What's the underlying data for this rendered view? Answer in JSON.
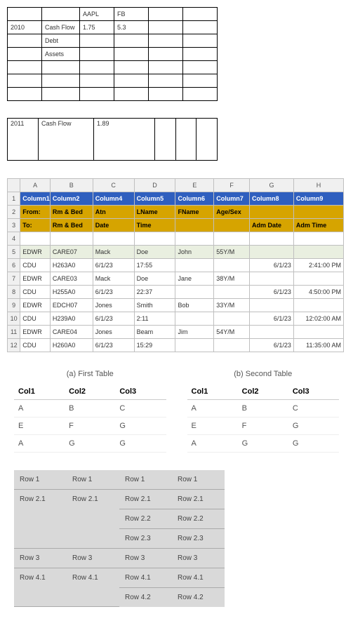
{
  "table1": {
    "headers": [
      "",
      "",
      "AAPL",
      "FB",
      "",
      ""
    ],
    "rows": [
      [
        "2010",
        "Cash Flow",
        "1.75",
        "5.3",
        "",
        ""
      ],
      [
        "",
        "Debt",
        "",
        "",
        "",
        ""
      ],
      [
        "",
        "Assets",
        "",
        "",
        "",
        ""
      ],
      [
        "",
        "",
        "",
        "",
        "",
        ""
      ],
      [
        "",
        "",
        "",
        "",
        "",
        ""
      ],
      [
        "",
        "",
        "",
        "",
        "",
        ""
      ]
    ],
    "lower": [
      "2011",
      "Cash Flow",
      "1.89",
      "",
      "",
      ""
    ]
  },
  "table2": {
    "col_letters": [
      "A",
      "B",
      "C",
      "D",
      "E",
      "F",
      "G",
      "H"
    ],
    "header_row": [
      "Column1",
      "Column2",
      "Column4",
      "Column5",
      "Column6",
      "Column7",
      "Column8",
      "Column9"
    ],
    "from_row": [
      "From:",
      "Rm & Bed",
      "Atn",
      "LName",
      "FName",
      "Age/Sex",
      "",
      ""
    ],
    "to_row": [
      "To:",
      "Rm & Bed",
      "Date",
      "Time",
      "",
      "",
      "Adm Date",
      "Adm Time"
    ],
    "data": [
      {
        "n": 5,
        "cells": [
          "EDWR",
          "CARE07",
          "Mack",
          "Doe",
          "John",
          "55Y/M",
          "",
          ""
        ]
      },
      {
        "n": 6,
        "cells": [
          "CDU",
          "H263A0",
          "6/1/23",
          "17:55",
          "",
          "",
          "6/1/23",
          "2:41:00 PM"
        ]
      },
      {
        "n": 7,
        "cells": [
          "EDWR",
          "CARE03",
          "Mack",
          "Doe",
          "Jane",
          "38Y/M",
          "",
          ""
        ]
      },
      {
        "n": 8,
        "cells": [
          "CDU",
          "H255A0",
          "6/1/23",
          "22:37",
          "",
          "",
          "6/1/23",
          "4:50:00 PM"
        ]
      },
      {
        "n": 9,
        "cells": [
          "EDWR",
          "EDCH07",
          "Jones",
          "Smith",
          "Bob",
          "33Y/M",
          "",
          ""
        ]
      },
      {
        "n": 10,
        "cells": [
          "CDU",
          "H239A0",
          "6/1/23",
          "2:11",
          "",
          "",
          "6/1/23",
          "12:02:00 AM"
        ]
      },
      {
        "n": 11,
        "cells": [
          "EDWR",
          "CARE04",
          "Jones",
          "Beam",
          "Jim",
          "54Y/M",
          "",
          ""
        ]
      },
      {
        "n": 12,
        "cells": [
          "CDU",
          "H260A0",
          "6/1/23",
          "15:29",
          "",
          "",
          "6/1/23",
          "11:35:00 AM"
        ]
      }
    ]
  },
  "table3": {
    "left_caption": "(a) First Table",
    "right_caption": "(b) Second Table",
    "headers": [
      "Col1",
      "Col2",
      "Col3"
    ],
    "left_rows": [
      [
        "A",
        "B",
        "C"
      ],
      [
        "E",
        "F",
        "G"
      ],
      [
        "A",
        "G",
        "G"
      ]
    ],
    "right_rows": [
      [
        "A",
        "B",
        "C"
      ],
      [
        "E",
        "F",
        "G"
      ],
      [
        "A",
        "G",
        "G"
      ]
    ]
  },
  "table4": {
    "groups": [
      {
        "c1": "Row 1",
        "c2": "Row 1",
        "rest": [
          [
            "Row 1",
            "Row 1"
          ]
        ]
      },
      {
        "c1": "Row 2.1",
        "c2": "Row 2.1",
        "rest": [
          [
            "Row 2.1",
            "Row 2.1"
          ],
          [
            "Row 2.2",
            "Row 2.2"
          ],
          [
            "Row 2.3",
            "Row 2.3"
          ]
        ]
      },
      {
        "c1": "Row 3",
        "c2": "Row 3",
        "rest": [
          [
            "Row 3",
            "Row 3"
          ]
        ]
      },
      {
        "c1": "Row 4.1",
        "c2": "Row 4.1",
        "rest": [
          [
            "Row 4.1",
            "Row 4.1"
          ],
          [
            "Row 4.2",
            "Row 4.2"
          ]
        ]
      }
    ]
  }
}
